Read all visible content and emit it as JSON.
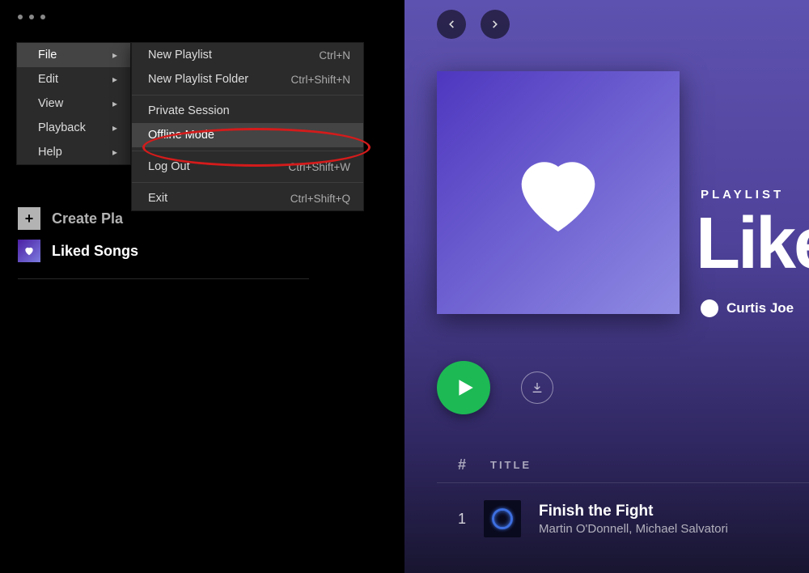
{
  "menu": {
    "main": [
      {
        "label": "File",
        "hover": true
      },
      {
        "label": "Edit",
        "hover": false
      },
      {
        "label": "View",
        "hover": false
      },
      {
        "label": "Playback",
        "hover": false
      },
      {
        "label": "Help",
        "hover": false
      }
    ],
    "sub": [
      {
        "label": "New Playlist",
        "shortcut": "Ctrl+N",
        "type": "item"
      },
      {
        "label": "New Playlist Folder",
        "shortcut": "Ctrl+Shift+N",
        "type": "item"
      },
      {
        "type": "sep"
      },
      {
        "label": "Private Session",
        "shortcut": "",
        "type": "item"
      },
      {
        "label": "Offline Mode",
        "shortcut": "",
        "type": "item",
        "hover": true
      },
      {
        "type": "sep"
      },
      {
        "label": "Log Out",
        "shortcut": "Ctrl+Shift+W",
        "type": "item"
      },
      {
        "type": "sep"
      },
      {
        "label": "Exit",
        "shortcut": "Ctrl+Shift+Q",
        "type": "item"
      }
    ]
  },
  "sidebar": {
    "create_label": "Create Pla",
    "liked_label": "Liked Songs"
  },
  "annotation": {
    "highlighted_item": "Offline Mode"
  },
  "playlist": {
    "type_label": "PLAYLIST",
    "title": "Like",
    "owner": "Curtis Joe",
    "header_hash": "#",
    "header_title": "TITLE",
    "tracks": [
      {
        "index": "1",
        "title": "Finish the Fight",
        "artist": "Martin O'Donnell, Michael Salvatori"
      }
    ]
  }
}
